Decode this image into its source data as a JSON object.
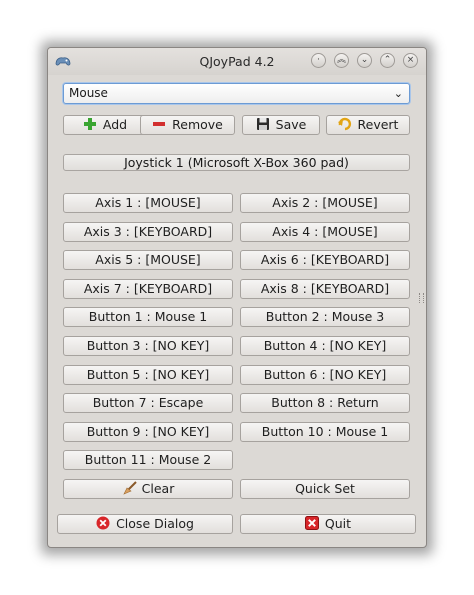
{
  "window": {
    "title": "QJoyPad 4.2"
  },
  "layout_selector": {
    "value": "Mouse"
  },
  "toolbar": {
    "add_label": "Add",
    "remove_label": "Remove",
    "save_label": "Save",
    "revert_label": "Revert"
  },
  "joystick": {
    "label": "Joystick 1 (Microsoft X-Box 360 pad)"
  },
  "mappings": [
    "Axis 1 : [MOUSE]",
    "Axis 2 : [MOUSE]",
    "Axis 3 : [KEYBOARD]",
    "Axis 4 : [MOUSE]",
    "Axis 5 : [MOUSE]",
    "Axis 6 : [KEYBOARD]",
    "Axis 7 : [KEYBOARD]",
    "Axis 8 : [KEYBOARD]",
    "Button 1 : Mouse 1",
    "Button 2 : Mouse 3",
    "Button 3 : [NO KEY]",
    "Button 4 : [NO KEY]",
    "Button 5 : [NO KEY]",
    "Button 6 : [NO KEY]",
    "Button 7 : Escape",
    "Button 8 : Return",
    "Button 9 : [NO KEY]",
    "Button 10 : Mouse 1",
    "Button 11 : Mouse 2"
  ],
  "actions": {
    "clear_label": "Clear",
    "quick_set_label": "Quick Set"
  },
  "footer": {
    "close_label": "Close Dialog",
    "quit_label": "Quit"
  }
}
